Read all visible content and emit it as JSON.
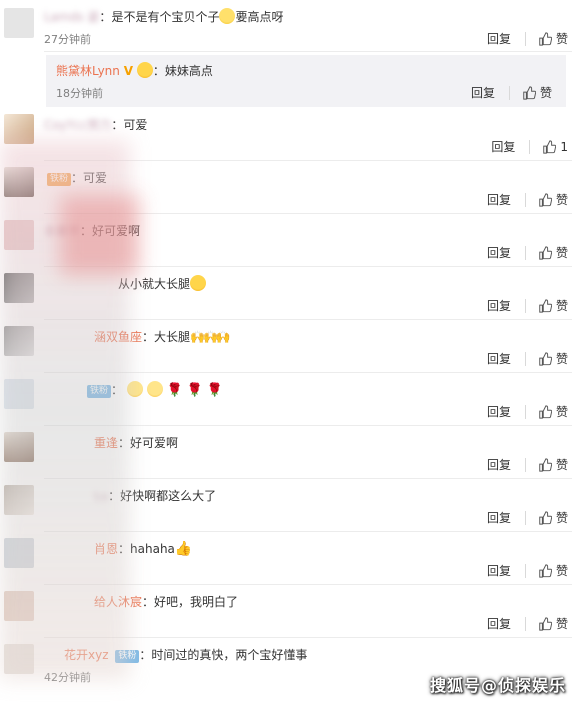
{
  "actions": {
    "reply_label": "回复",
    "like_label": "赞"
  },
  "comments": [
    {
      "user": "Lamds 姿",
      "sep": "：",
      "text_a": "是不是有个宝贝个子",
      "text_b": "要高点呀",
      "time": "27分钟前",
      "like": "赞"
    },
    {
      "user": "CoyYcc努力",
      "sep": "：",
      "text_a": "可爱",
      "time": "",
      "like": "1"
    },
    {
      "user": "",
      "badge": "铁粉",
      "sep": "：",
      "text_a": "可爱",
      "time": "",
      "like": "赞"
    },
    {
      "user": "亲慕苹",
      "sep": "：",
      "text_a": "好可爱啊",
      "time": "",
      "like": "赞"
    },
    {
      "user": "",
      "sep": "",
      "text_a": "从小就大长腿",
      "time": "",
      "like": "赞"
    },
    {
      "user": "涵双鱼座",
      "sep": "：",
      "text_a": "大长腿",
      "time": "",
      "like": "赞"
    },
    {
      "user": "",
      "badge": "铁粉",
      "sep": "：",
      "text_a": "",
      "time": "",
      "like": "赞"
    },
    {
      "user": "重逢",
      "sep": "：",
      "text_a": "好可爱啊",
      "time": "",
      "like": "赞"
    },
    {
      "user": "Lu",
      "sep": "：",
      "text_a": "好快啊都这么大了",
      "time": "",
      "like": "赞"
    },
    {
      "user": "肖恩",
      "sep": "：",
      "text_a": "hahaha",
      "time": "",
      "like": "赞"
    },
    {
      "user": "给人沐宸",
      "sep": "：",
      "text_a": "好吧，我明白了",
      "time": "",
      "like": "赞"
    },
    {
      "user": "花开xyz",
      "badge": "铁粉",
      "sep": "：",
      "text_a": "时间过的真快，两个宝好懂事",
      "time": "42分钟前",
      "like": ""
    }
  ],
  "subreply": {
    "user": "熊黛林Lynn",
    "sep": "：",
    "text": "妹妹高点",
    "time": "18分钟前",
    "like": "赞"
  },
  "watermark": "搜狐号@侦探娱乐",
  "colors": {
    "username": "#eb7350",
    "subreply_bg": "#f2f2f5",
    "iron_fan_badge": "#7ab8e6"
  }
}
